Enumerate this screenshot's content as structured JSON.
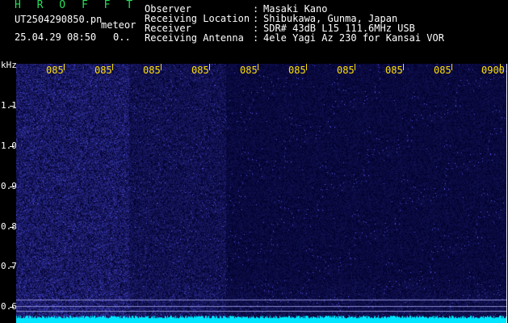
{
  "header": {
    "logo": "H R O F F T",
    "filename": "UT2504290850.pn",
    "tag": "meteor",
    "timestamp": "25.04.29 08:50",
    "count": "0..",
    "fields": [
      {
        "label": "Observer",
        "value": "Masaki Kano"
      },
      {
        "label": "Receiving Location",
        "value": "Shibukawa, Gunma, Japan"
      },
      {
        "label": "Receiver",
        "value": "SDR# 43dB L15 111.6MHz USB"
      },
      {
        "label": "Receiving Antenna",
        "value": "4ele Yagi Az 230 for Kansai VOR"
      }
    ],
    "separator": ":"
  },
  "waterfall": {
    "y_unit": "kHz",
    "y_ticks": [
      "1.1",
      "1.0",
      "0.9",
      "0.8",
      "0.7",
      "0.6"
    ],
    "x_ticks": [
      "085",
      "085",
      "085",
      "085",
      "085",
      "085",
      "085",
      "085",
      "085",
      "0900"
    ],
    "colors": {
      "noise": "#2020a0",
      "signal": "#00e5ff",
      "tick": "#ffe000"
    }
  }
}
